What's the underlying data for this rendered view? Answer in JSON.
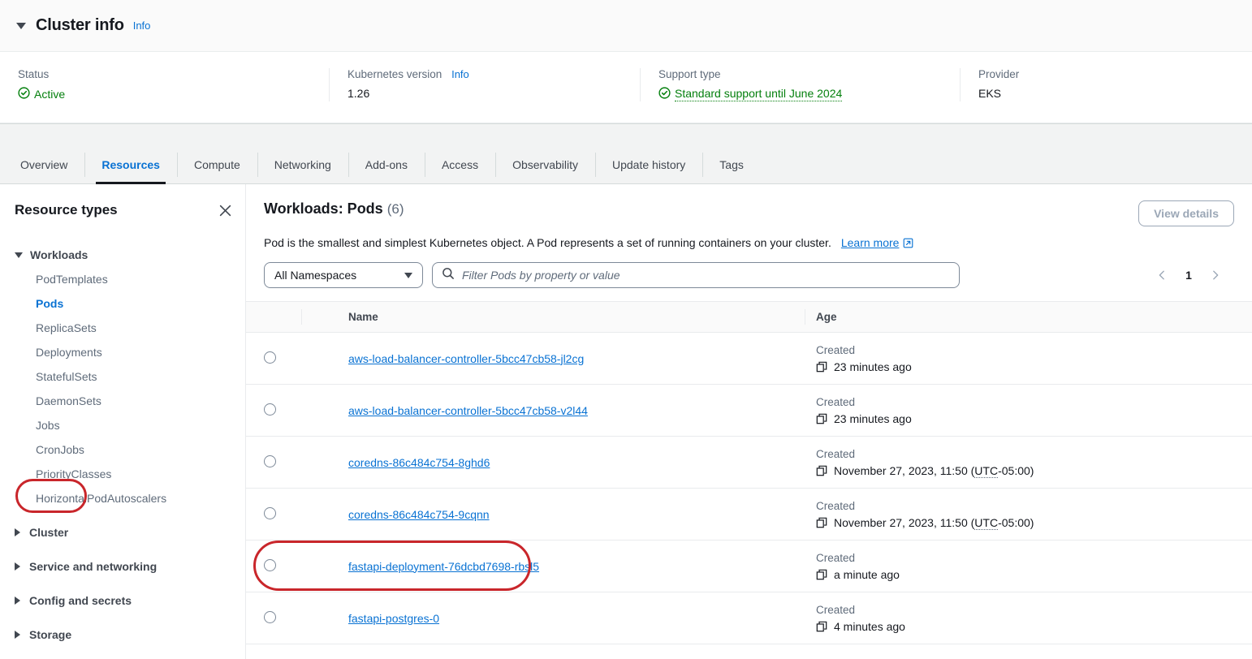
{
  "cluster_info": {
    "title": "Cluster info",
    "info_label": "Info",
    "properties": [
      {
        "label": "Status",
        "value": "Active",
        "has_check": true,
        "info": null
      },
      {
        "label": "Kubernetes version",
        "value": "1.26",
        "has_check": false,
        "info": "Info"
      },
      {
        "label": "Support type",
        "value": "Standard support until June 2024",
        "has_check": true,
        "info": null
      },
      {
        "label": "Provider",
        "value": "EKS",
        "has_check": false,
        "info": null
      }
    ]
  },
  "tabs": [
    {
      "label": "Overview",
      "active": false
    },
    {
      "label": "Resources",
      "active": true
    },
    {
      "label": "Compute",
      "active": false
    },
    {
      "label": "Networking",
      "active": false
    },
    {
      "label": "Add-ons",
      "active": false
    },
    {
      "label": "Access",
      "active": false
    },
    {
      "label": "Observability",
      "active": false
    },
    {
      "label": "Update history",
      "active": false
    },
    {
      "label": "Tags",
      "active": false
    }
  ],
  "sidebar": {
    "title": "Resource types",
    "close_icon": "close-icon",
    "groups": [
      {
        "label": "Workloads",
        "expanded": true,
        "items": [
          {
            "label": "PodTemplates",
            "selected": false
          },
          {
            "label": "Pods",
            "selected": true
          },
          {
            "label": "ReplicaSets",
            "selected": false
          },
          {
            "label": "Deployments",
            "selected": false
          },
          {
            "label": "StatefulSets",
            "selected": false
          },
          {
            "label": "DaemonSets",
            "selected": false
          },
          {
            "label": "Jobs",
            "selected": false
          },
          {
            "label": "CronJobs",
            "selected": false
          },
          {
            "label": "PriorityClasses",
            "selected": false
          },
          {
            "label": "HorizontalPodAutoscalers",
            "selected": false
          }
        ]
      },
      {
        "label": "Cluster",
        "expanded": false,
        "items": []
      },
      {
        "label": "Service and networking",
        "expanded": false,
        "items": []
      },
      {
        "label": "Config and secrets",
        "expanded": false,
        "items": []
      },
      {
        "label": "Storage",
        "expanded": false,
        "items": []
      }
    ]
  },
  "main": {
    "title": "Workloads: Pods",
    "count": "(6)",
    "view_details_label": "View details",
    "description": "Pod is the smallest and simplest Kubernetes object. A Pod represents a set of running containers on your cluster.",
    "learn_more_label": "Learn more",
    "namespace_select": {
      "value": "All Namespaces"
    },
    "search": {
      "value": "",
      "placeholder": "Filter Pods by property or value"
    },
    "pagination": {
      "page": "1",
      "prev_icon": "chevron-left-icon",
      "next_icon": "chevron-right-icon"
    },
    "table": {
      "columns": [
        "Name",
        "Age"
      ],
      "age_created_label": "Created",
      "rows": [
        {
          "name": "aws-load-balancer-controller-5bcc47cb58-jl2cg",
          "created": "Created",
          "age": "23 minutes ago",
          "abbr": null,
          "highlighted": false
        },
        {
          "name": "aws-load-balancer-controller-5bcc47cb58-v2l44",
          "created": "Created",
          "age": "23 minutes ago",
          "abbr": null,
          "highlighted": false
        },
        {
          "name": "coredns-86c484c754-8ghd6",
          "created": "Created",
          "age": "November 27, 2023, 11:50 (UTC-05:00)",
          "abbr": "UTC",
          "highlighted": false
        },
        {
          "name": "coredns-86c484c754-9cqnn",
          "created": "Created",
          "age": "November 27, 2023, 11:50 (UTC-05:00)",
          "abbr": "UTC",
          "highlighted": false
        },
        {
          "name": "fastapi-deployment-76dcbd7698-rbsl5",
          "created": "Created",
          "age": "a minute ago",
          "abbr": null,
          "highlighted": true
        },
        {
          "name": "fastapi-postgres-0",
          "created": "Created",
          "age": "4 minutes ago",
          "abbr": null,
          "highlighted": false
        }
      ]
    }
  },
  "colors": {
    "link": "#0972d3",
    "success": "#037f0c",
    "annotation_red": "#c9262b",
    "text": "#16191f",
    "muted": "#5f6b7a"
  }
}
